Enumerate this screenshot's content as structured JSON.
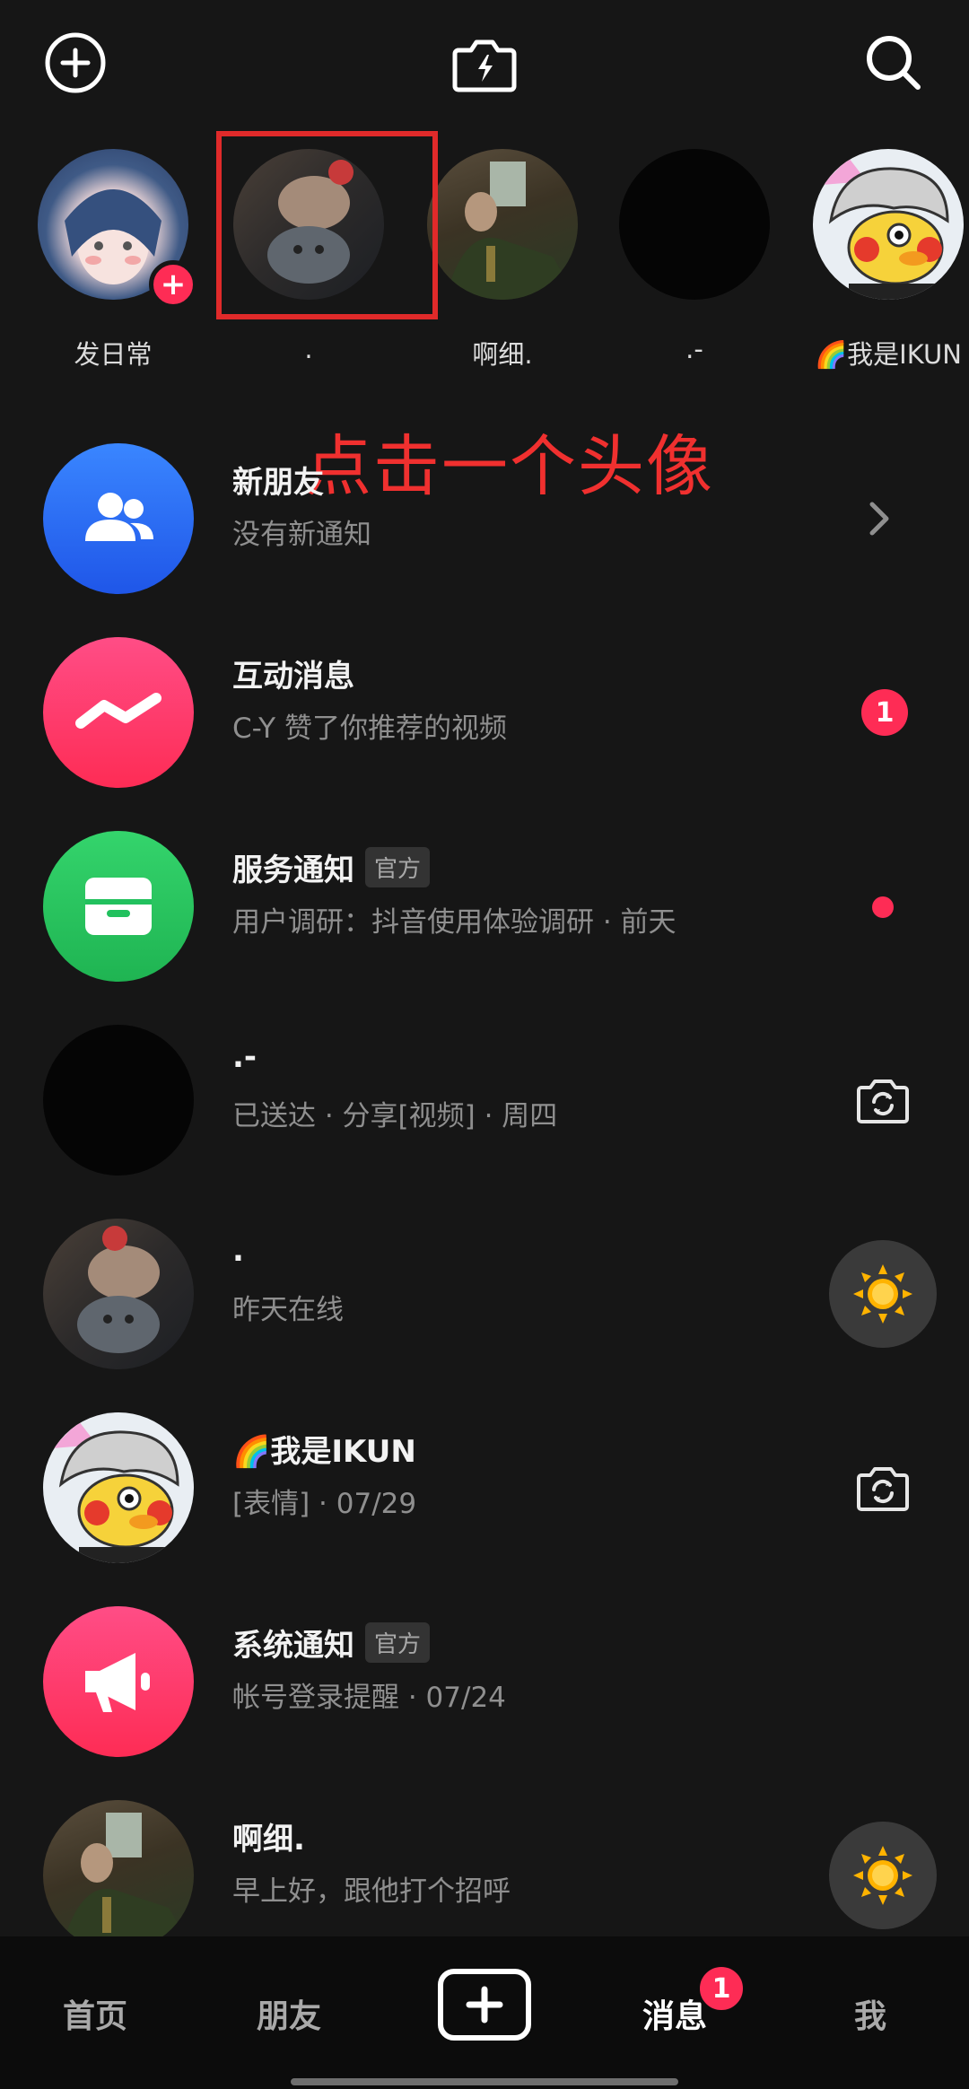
{
  "header": {
    "add_icon": "plus-circle-icon",
    "flash_camera_icon": "lightning-camera-icon",
    "search_icon": "search-icon"
  },
  "stories": [
    {
      "name": "发日常",
      "has_add_badge": true,
      "add_badge": "+"
    },
    {
      "name": ".",
      "highlighted": true
    },
    {
      "name": "啊细."
    },
    {
      "name": ".-"
    },
    {
      "name": "🌈我是IKUN"
    }
  ],
  "annotation": "点击一个头像",
  "messages": [
    {
      "title": "新朋友",
      "subtitle": "没有新通知",
      "trailing": "chevron",
      "icon": "people-icon",
      "color": "#2b66f6"
    },
    {
      "title": "互动消息",
      "subtitle": "C-Y 赞了你推荐的视频",
      "trailing": "badge",
      "badge": "1",
      "icon": "zigzag-icon",
      "color": "#fe2c55"
    },
    {
      "title": "服务通知",
      "tag": "官方",
      "subtitle": "用户调研：抖音使用体验调研 · 前天",
      "trailing": "dot",
      "icon": "inbox-icon",
      "color": "#22c15e"
    },
    {
      "title": ".-",
      "subtitle": "已送达 · 分享[视频] · 周四",
      "trailing": "camera",
      "icon": "avatar"
    },
    {
      "title": ".",
      "subtitle": "昨天在线",
      "trailing": "sun",
      "icon": "avatar"
    },
    {
      "title": "🌈我是IKUN",
      "subtitle": "[表情] · 07/29",
      "trailing": "camera",
      "icon": "avatar"
    },
    {
      "title": "系统通知",
      "tag": "官方",
      "subtitle": "帐号登录提醒 · 07/24",
      "trailing": "none",
      "icon": "megaphone-icon",
      "color": "#fe2c55"
    },
    {
      "title": "啊细.",
      "subtitle": "早上好，跟他打个招呼",
      "trailing": "sun",
      "icon": "avatar"
    }
  ],
  "bottom_nav": {
    "home": "首页",
    "friends": "朋友",
    "create_icon": "plus-icon",
    "messages": "消息",
    "messages_badge": "1",
    "me": "我"
  },
  "colors": {
    "background": "#161616",
    "accent": "#fe2c55",
    "annotation": "#f0302f"
  }
}
